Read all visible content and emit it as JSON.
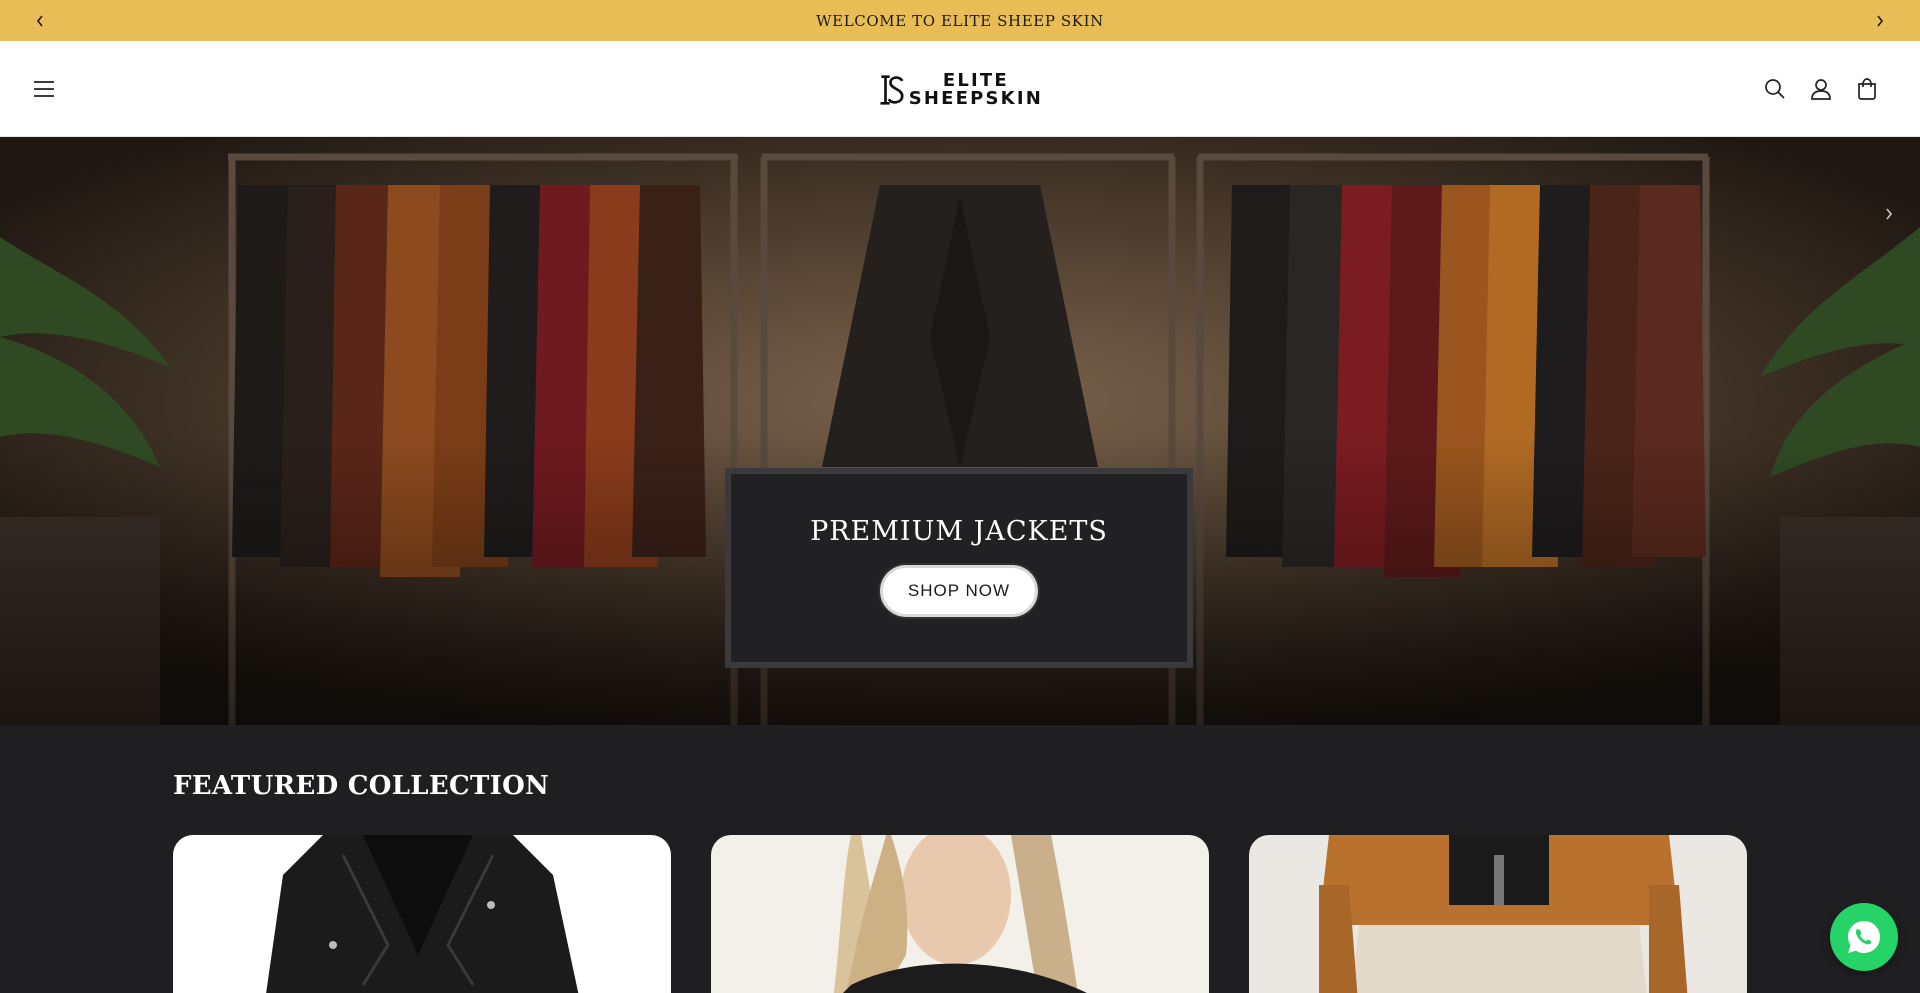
{
  "announcement": {
    "text": "WELCOME TO ELITE SHEEP SKIN",
    "prev_icon": "chevron-left-icon",
    "next_icon": "chevron-right-icon",
    "background": "#e9bd56"
  },
  "header": {
    "logo_line1": "ELITE",
    "logo_line2": "SHEEPSKIN",
    "icons": [
      "menu-icon",
      "search-icon",
      "account-icon",
      "cart-icon"
    ]
  },
  "hero": {
    "title": "PREMIUM JACKETS",
    "cta_label": "SHOP NOW"
  },
  "featured": {
    "title": "FEATURED COLLECTION"
  },
  "floating": {
    "icon": "whatsapp-icon",
    "color": "#25d366"
  }
}
